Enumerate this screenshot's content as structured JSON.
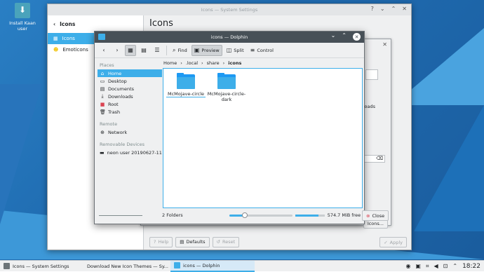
{
  "desktop": {
    "icon_label": "Install Kaan user"
  },
  "settings": {
    "window_title": "Icons — System Settings",
    "sidebar_header": "Icons",
    "sidebar_items": [
      {
        "label": "Icons",
        "icon": "icons-module-icon",
        "selected": true
      },
      {
        "label": "Emoticons",
        "icon": "emoticon-icon",
        "selected": false
      }
    ],
    "page_title": "Icons",
    "buttons": {
      "help": "Help",
      "defaults": "Defaults",
      "reset": "Reset",
      "apply": "Apply"
    }
  },
  "inner_dialog": {
    "fragment_text": "oads",
    "icons_button": "Icons...",
    "close_button": "Close"
  },
  "dolphin": {
    "window_title": "icons — Dolphin",
    "toolbar": {
      "find": "Find",
      "preview": "Preview",
      "split": "Split",
      "control": "Control"
    },
    "breadcrumb": [
      "Home",
      ".local",
      "share",
      "icons"
    ],
    "places": {
      "header": "Places",
      "items": [
        {
          "label": "Home",
          "icon": "home-icon",
          "selected": true
        },
        {
          "label": "Desktop",
          "icon": "desktop-icon",
          "selected": false
        },
        {
          "label": "Documents",
          "icon": "documents-icon",
          "selected": false
        },
        {
          "label": "Downloads",
          "icon": "downloads-icon",
          "selected": false
        },
        {
          "label": "Root",
          "icon": "root-folder-icon",
          "selected": false
        },
        {
          "label": "Trash",
          "icon": "trash-icon",
          "selected": false
        }
      ],
      "remote_header": "Remote",
      "remote_items": [
        {
          "label": "Network",
          "icon": "network-icon"
        }
      ],
      "removable_header": "Removable Devices",
      "removable_items": [
        {
          "label": "neon user 20190627-11:3",
          "icon": "drive-icon"
        }
      ]
    },
    "folders": [
      {
        "name": "McMojave-circle"
      },
      {
        "name": "McMojave-circle-dark"
      }
    ],
    "status": {
      "count": "2 Folders",
      "free_space": "574.7 MiB free",
      "zoom_fraction": 0.25,
      "space_used_fraction": 0.8
    }
  },
  "taskbar": {
    "tasks": [
      {
        "label": "Icons — System Settings",
        "active": false
      },
      {
        "label": "Download New Icon Themes — Sy...",
        "active": false
      },
      {
        "label": "icons — Dolphin",
        "active": true
      }
    ],
    "clock": "18:22"
  },
  "colors": {
    "accent": "#3daee9",
    "titlebar_dark": "#475057",
    "desktop_bg": "#1f6bb0"
  }
}
